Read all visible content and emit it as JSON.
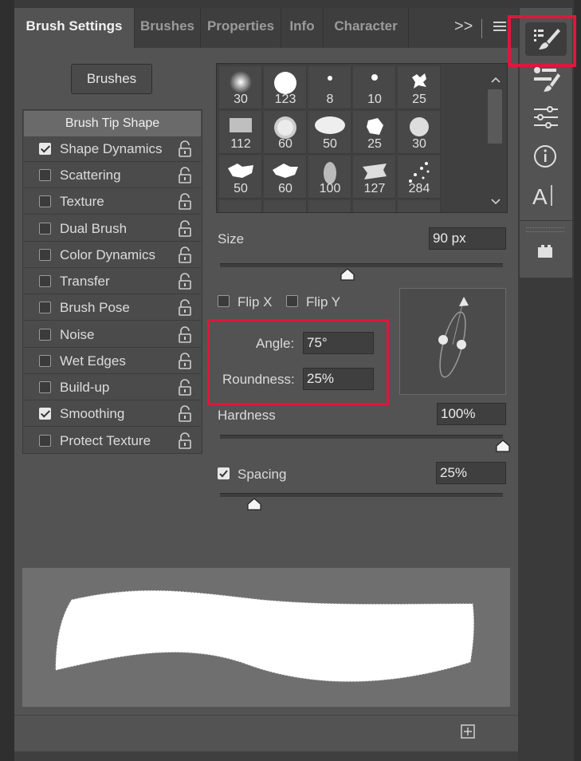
{
  "tabs": [
    {
      "label": "Brush Settings",
      "active": true
    },
    {
      "label": "Brushes",
      "active": false
    },
    {
      "label": "Properties",
      "active": false
    },
    {
      "label": "Info",
      "active": false
    },
    {
      "label": "Character",
      "active": false
    }
  ],
  "tab_overflow_label": ">>",
  "brushes_button": "Brushes",
  "options": {
    "header": "Brush Tip Shape",
    "items": [
      {
        "label": "Shape Dynamics",
        "checked": true
      },
      {
        "label": "Scattering",
        "checked": false
      },
      {
        "label": "Texture",
        "checked": false
      },
      {
        "label": "Dual Brush",
        "checked": false
      },
      {
        "label": "Color Dynamics",
        "checked": false
      },
      {
        "label": "Transfer",
        "checked": false
      },
      {
        "label": "Brush Pose",
        "checked": false
      },
      {
        "label": "Noise",
        "checked": false
      },
      {
        "label": "Wet Edges",
        "checked": false
      },
      {
        "label": "Build-up",
        "checked": false
      },
      {
        "label": "Smoothing",
        "checked": true
      },
      {
        "label": "Protect Texture",
        "checked": false
      }
    ]
  },
  "brush_presets": [
    "30",
    "123",
    "8",
    "10",
    "25",
    "112",
    "60",
    "50",
    "25",
    "30",
    "50",
    "60",
    "100",
    "127",
    "284"
  ],
  "size": {
    "label": "Size",
    "value": "90 px",
    "slider_fraction": 0.45
  },
  "flip_x": {
    "label": "Flip X",
    "checked": false
  },
  "flip_y": {
    "label": "Flip Y",
    "checked": false
  },
  "angle": {
    "label": "Angle:",
    "value": "75°"
  },
  "roundness": {
    "label": "Roundness:",
    "value": "25%"
  },
  "hardness": {
    "label": "Hardness",
    "value": "100%",
    "slider_fraction": 1.0
  },
  "spacing": {
    "label": "Spacing",
    "value": "25%",
    "checked": true,
    "slider_fraction": 0.12
  },
  "colors": {
    "highlight": "#e0163b",
    "panel": "#535353",
    "tab_bar": "#3e3e3e"
  }
}
